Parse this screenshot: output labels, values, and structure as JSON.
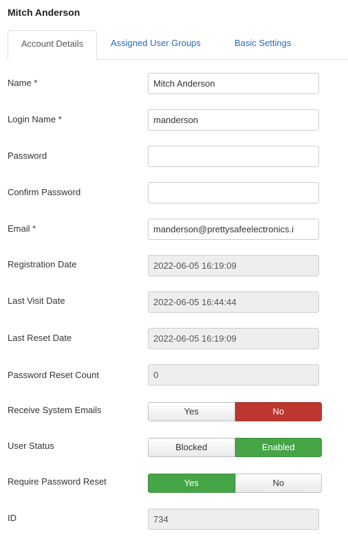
{
  "page": {
    "title": "Mitch Anderson"
  },
  "tabs": [
    {
      "label": "Account Details"
    },
    {
      "label": "Assigned User Groups"
    },
    {
      "label": "Basic Settings"
    }
  ],
  "form": {
    "name": {
      "label": "Name *",
      "value": "Mitch Anderson"
    },
    "login": {
      "label": "Login Name *",
      "value": "manderson"
    },
    "password": {
      "label": "Password",
      "value": ""
    },
    "confirm_password": {
      "label": "Confirm Password",
      "value": ""
    },
    "email": {
      "label": "Email *",
      "value": "manderson@prettysafeelectronics.i"
    },
    "registration_date": {
      "label": "Registration Date",
      "value": "2022-06-05 16:19:09"
    },
    "last_visit_date": {
      "label": "Last Visit Date",
      "value": "2022-06-05 16:44:44"
    },
    "last_reset_date": {
      "label": "Last Reset Date",
      "value": "2022-06-05 16:19:09"
    },
    "password_reset_count": {
      "label": "Password Reset Count",
      "value": "0"
    },
    "receive_system_emails": {
      "label": "Receive System Emails",
      "options": [
        "Yes",
        "No"
      ],
      "selected": "No"
    },
    "user_status": {
      "label": "User Status",
      "options": [
        "Blocked",
        "Enabled"
      ],
      "selected": "Enabled"
    },
    "require_password_reset": {
      "label": "Require Password Reset",
      "options": [
        "Yes",
        "No"
      ],
      "selected": "Yes"
    },
    "id": {
      "label": "ID",
      "value": "734"
    }
  },
  "colors": {
    "link": "#2a69b8",
    "toggle_on_red": "#bd362f",
    "toggle_on_green": "#46a546",
    "readonly_bg": "#eeeeee"
  }
}
